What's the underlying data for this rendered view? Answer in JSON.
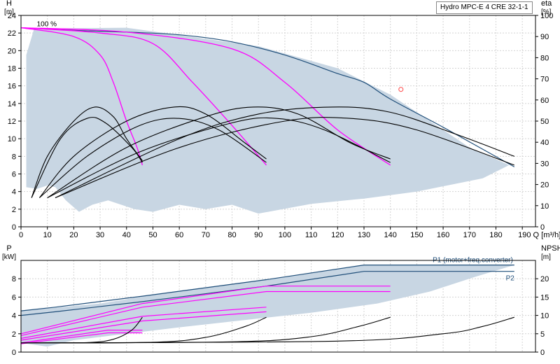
{
  "chart_data": [
    {
      "type": "line",
      "title": "Hydro MPC-E 4 CRE 32-1-1",
      "left_axis": {
        "unit_symbol": "H",
        "unit": "[m]",
        "ylim": [
          0,
          24
        ],
        "ticks": [
          0,
          2,
          4,
          6,
          8,
          10,
          12,
          14,
          16,
          18,
          20,
          22,
          24
        ]
      },
      "right_axis": {
        "unit_symbol": "eta",
        "unit": "[%]",
        "ylim": [
          0,
          100
        ],
        "ticks": [
          0,
          10,
          20,
          30,
          40,
          50,
          60,
          70,
          80,
          90,
          100
        ]
      },
      "x_axis": {
        "label": "Q [m³/h]",
        "xlim": [
          0,
          195
        ],
        "ticks": [
          0,
          10,
          20,
          30,
          40,
          50,
          60,
          70,
          80,
          90,
          100,
          110,
          120,
          130,
          140,
          150,
          160,
          170,
          180,
          190
        ]
      },
      "speed_label": {
        "text": "100 %",
        "x": 6,
        "y": 22.6
      },
      "grid": true,
      "colors": {
        "envelope": "#c8d6e3",
        "max_curve": "#1f4e79",
        "reduced_speed": "#ff00ff",
        "efficiency": "#000000",
        "duty_marker": "#ff4444"
      },
      "operating_area": [
        [
          2,
          4.5
        ],
        [
          2,
          19.5
        ],
        [
          5,
          22.5
        ],
        [
          40,
          22.6
        ],
        [
          90,
          20.5
        ],
        [
          120,
          18
        ],
        [
          140,
          15
        ],
        [
          170,
          9
        ],
        [
          185,
          7
        ],
        [
          175,
          5.5
        ],
        [
          150,
          4
        ],
        [
          130,
          3.2
        ],
        [
          110,
          2.6
        ],
        [
          90,
          1.5
        ],
        [
          80,
          2.5
        ],
        [
          70,
          2
        ],
        [
          60,
          2.5
        ],
        [
          50,
          1.7
        ],
        [
          43,
          2
        ],
        [
          33,
          3
        ],
        [
          27,
          2.5
        ],
        [
          22,
          1.7
        ],
        [
          17,
          3
        ],
        [
          13,
          4.5
        ],
        [
          10,
          4.7
        ],
        [
          6,
          4.3
        ]
      ],
      "series": [
        {
          "role": "max-head",
          "points": [
            [
              0,
              22.6
            ],
            [
              20,
              22.3
            ],
            [
              40,
              22.1
            ],
            [
              60,
              21.8
            ],
            [
              80,
              21
            ],
            [
              100,
              19.5
            ],
            [
              120,
              17.4
            ],
            [
              130,
              16.4
            ],
            [
              140,
              14.5
            ],
            [
              160,
              11.3
            ],
            [
              187,
              6.8
            ]
          ]
        },
        {
          "role": "reduced-speed",
          "points": [
            [
              0,
              22.6
            ],
            [
              20,
              21.6
            ],
            [
              30,
              19.5
            ],
            [
              35,
              16.4
            ],
            [
              40,
              12
            ],
            [
              44,
              9
            ],
            [
              46,
              7
            ]
          ]
        },
        {
          "role": "reduced-speed",
          "points": [
            [
              0,
              22.6
            ],
            [
              30,
              22
            ],
            [
              50,
              20.8
            ],
            [
              65,
              16.4
            ],
            [
              80,
              11.5
            ],
            [
              93,
              7
            ]
          ]
        },
        {
          "role": "reduced-speed",
          "points": [
            [
              0,
              22.6
            ],
            [
              40,
              22.1
            ],
            [
              80,
              20.2
            ],
            [
              100,
              16.4
            ],
            [
              120,
              11
            ],
            [
              140,
              7
            ]
          ]
        },
        {
          "role": "efficiency-1",
          "points": [
            [
              4,
              3.3
            ],
            [
              10,
              8
            ],
            [
              20,
              12
            ],
            [
              28,
              13.6
            ],
            [
              35,
              12.5
            ],
            [
              40,
              10
            ],
            [
              46,
              7.5
            ]
          ]
        },
        {
          "role": "efficiency-1",
          "points": [
            [
              4,
              3.3
            ],
            [
              15,
              10
            ],
            [
              25,
              12.3
            ],
            [
              32,
              11.8
            ],
            [
              42,
              9
            ],
            [
              46,
              7.3
            ]
          ]
        },
        {
          "role": "efficiency-2",
          "points": [
            [
              7,
              3.3
            ],
            [
              20,
              8
            ],
            [
              40,
              12
            ],
            [
              58,
              13.6
            ],
            [
              70,
              12.8
            ],
            [
              85,
              9.5
            ],
            [
              93,
              7.7
            ]
          ]
        },
        {
          "role": "efficiency-2",
          "points": [
            [
              7,
              3.3
            ],
            [
              25,
              8
            ],
            [
              45,
              11.5
            ],
            [
              60,
              12.3
            ],
            [
              75,
              11
            ],
            [
              93,
              7.3
            ]
          ]
        },
        {
          "role": "efficiency-3",
          "points": [
            [
              10,
              3.3
            ],
            [
              40,
              9
            ],
            [
              70,
              12.5
            ],
            [
              88,
              13.6
            ],
            [
              105,
              12.8
            ],
            [
              125,
              9.5
            ],
            [
              140,
              7.7
            ]
          ]
        },
        {
          "role": "efficiency-3",
          "points": [
            [
              10,
              3.3
            ],
            [
              45,
              8.5
            ],
            [
              80,
              11.8
            ],
            [
              97,
              12.3
            ],
            [
              115,
              11
            ],
            [
              140,
              7.3
            ]
          ]
        },
        {
          "role": "efficiency-4",
          "points": [
            [
              13,
              3.3
            ],
            [
              60,
              10
            ],
            [
              90,
              12.8
            ],
            [
              118,
              13.6
            ],
            [
              140,
              13
            ],
            [
              165,
              10.5
            ],
            [
              187,
              8
            ]
          ]
        },
        {
          "role": "efficiency-4",
          "points": [
            [
              13,
              3.3
            ],
            [
              60,
              9
            ],
            [
              100,
              12
            ],
            [
              125,
              12.3
            ],
            [
              150,
              11
            ],
            [
              187,
              7
            ]
          ]
        }
      ],
      "duty_point": {
        "x": 144,
        "y": 15.6
      }
    },
    {
      "type": "line",
      "left_axis": {
        "unit_symbol": "P",
        "unit": "[kW]",
        "ylim": [
          0,
          10
        ],
        "ticks": [
          0,
          2,
          4,
          6,
          8
        ]
      },
      "right_axis": {
        "unit_symbol": "NPSH",
        "unit": "[m]",
        "ylim": [
          0,
          25
        ],
        "ticks": [
          0,
          5,
          10,
          15,
          20
        ]
      },
      "x_axis": {
        "xlim": [
          0,
          195
        ]
      },
      "grid": true,
      "legend_labels": {
        "p1": "P1 (motor+freq.converter)",
        "p2": "P2"
      },
      "power_area": [
        [
          0,
          1
        ],
        [
          0,
          4.5
        ],
        [
          30,
          5.3
        ],
        [
          60,
          6.7
        ],
        [
          90,
          7.8
        ],
        [
          130,
          9.5
        ],
        [
          187,
          9.5
        ],
        [
          172,
          8.2
        ],
        [
          155,
          6.6
        ],
        [
          135,
          5.3
        ],
        [
          110,
          4.3
        ],
        [
          85,
          3.5
        ],
        [
          60,
          2.7
        ],
        [
          40,
          2
        ],
        [
          20,
          1.3
        ],
        [
          10,
          0.6
        ]
      ],
      "series": [
        {
          "role": "p1-max",
          "points": [
            [
              0,
              4.5
            ],
            [
              13,
              4.9
            ],
            [
              46,
              6.1
            ],
            [
              93,
              7.9
            ],
            [
              130,
              9.5
            ],
            [
              187,
              9.5
            ]
          ]
        },
        {
          "role": "p2-max",
          "points": [
            [
              0,
              4
            ],
            [
              13,
              4.4
            ],
            [
              46,
              5.5
            ],
            [
              93,
              7.2
            ],
            [
              130,
              8.8
            ],
            [
              187,
              8.8
            ]
          ]
        },
        {
          "role": "p1-reduced",
          "points": [
            [
              0,
              2
            ],
            [
              46,
              5.3
            ],
            [
              93,
              7.2
            ],
            [
              140,
              7.2
            ]
          ]
        },
        {
          "role": "p2-reduced",
          "points": [
            [
              0,
              1.8
            ],
            [
              46,
              4.9
            ],
            [
              93,
              6.6
            ],
            [
              140,
              6.6
            ]
          ]
        },
        {
          "role": "p1-reduced",
          "points": [
            [
              0,
              1.5
            ],
            [
              46,
              3.9
            ],
            [
              93,
              4.9
            ]
          ]
        },
        {
          "role": "p2-reduced",
          "points": [
            [
              0,
              1.3
            ],
            [
              46,
              3.4
            ],
            [
              93,
              4.4
            ]
          ]
        },
        {
          "role": "p1-reduced",
          "points": [
            [
              0,
              1
            ],
            [
              33,
              2.4
            ],
            [
              46,
              2.4
            ]
          ]
        },
        {
          "role": "p2-reduced",
          "points": [
            [
              0,
              0.9
            ],
            [
              33,
              2.1
            ],
            [
              46,
              2.1
            ]
          ]
        },
        {
          "role": "npsh",
          "points": [
            [
              0,
              2.5
            ],
            [
              25,
              2.6
            ],
            [
              35,
              3.5
            ],
            [
              42,
              6
            ],
            [
              46,
              9.5
            ]
          ]
        },
        {
          "role": "npsh",
          "points": [
            [
              0,
              2.5
            ],
            [
              50,
              2.7
            ],
            [
              70,
              4
            ],
            [
              85,
              7
            ],
            [
              93,
              9.5
            ]
          ]
        },
        {
          "role": "npsh",
          "points": [
            [
              0,
              2.5
            ],
            [
              80,
              2.8
            ],
            [
              110,
              4.2
            ],
            [
              128,
              7
            ],
            [
              140,
              9.5
            ]
          ]
        },
        {
          "role": "npsh",
          "points": [
            [
              0,
              2.5
            ],
            [
              120,
              3
            ],
            [
              160,
              5
            ],
            [
              175,
              7
            ],
            [
              187,
              9.5
            ]
          ]
        }
      ]
    }
  ]
}
